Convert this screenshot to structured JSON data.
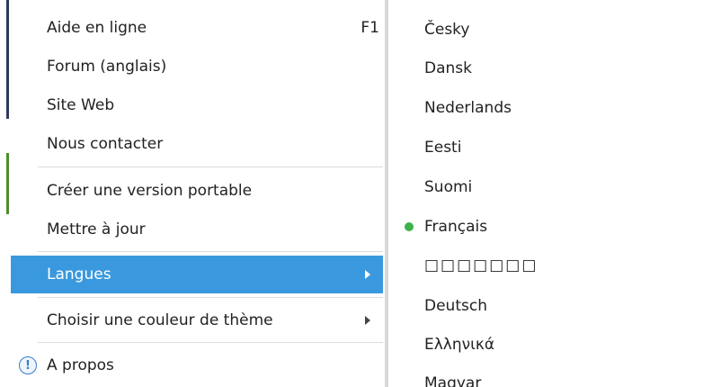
{
  "main_menu": {
    "items": [
      {
        "label": "Aide en ligne",
        "shortcut": "F1"
      },
      {
        "label": "Forum (anglais)"
      },
      {
        "label": "Site Web"
      },
      {
        "label": "Nous contacter"
      },
      {
        "label": "Créer une version portable"
      },
      {
        "label": "Mettre à jour"
      },
      {
        "label": "Langues"
      },
      {
        "label": "Choisir une couleur de thème"
      },
      {
        "label": "A propos"
      }
    ]
  },
  "languages": {
    "items": [
      {
        "label": "Česky"
      },
      {
        "label": "Dansk"
      },
      {
        "label": "Nederlands"
      },
      {
        "label": "Eesti"
      },
      {
        "label": "Suomi"
      },
      {
        "label": "Français"
      },
      {
        "label": "□□□□□□□"
      },
      {
        "label": "Deutsch"
      },
      {
        "label": "Ελληνικά"
      },
      {
        "label": "Magyar"
      }
    ],
    "selected": "Français"
  },
  "colors": {
    "highlight": "#3a99de",
    "selected_dot": "#3fb24b",
    "info_icon": "#3a7bc8"
  },
  "icons": {
    "submenu_arrow": "triangle-right",
    "about": "info-circle",
    "selected_language": "green-dot"
  }
}
